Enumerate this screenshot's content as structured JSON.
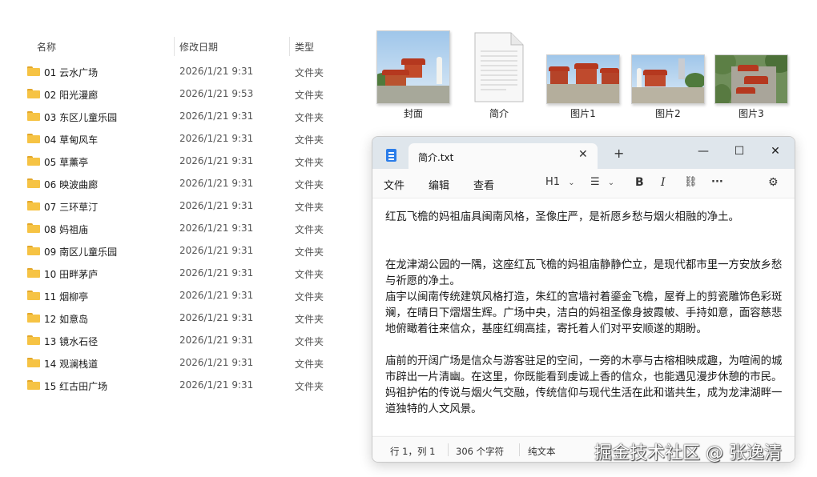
{
  "columns": {
    "name": "名称",
    "date": "修改日期",
    "type": "类型"
  },
  "rows": [
    {
      "name": "01 云水广场",
      "date": "2026/1/21 9:31",
      "type": "文件夹"
    },
    {
      "name": "02 阳光漫廊",
      "date": "2026/1/21 9:53",
      "type": "文件夹"
    },
    {
      "name": "03 东区儿童乐园",
      "date": "2026/1/21 9:31",
      "type": "文件夹"
    },
    {
      "name": "04 草甸风车",
      "date": "2026/1/21 9:31",
      "type": "文件夹"
    },
    {
      "name": "05 草薰亭",
      "date": "2026/1/21 9:31",
      "type": "文件夹"
    },
    {
      "name": "06 映波曲廊",
      "date": "2026/1/21 9:31",
      "type": "文件夹"
    },
    {
      "name": "07 三环草汀",
      "date": "2026/1/21 9:31",
      "type": "文件夹"
    },
    {
      "name": "08 妈祖庙",
      "date": "2026/1/21 9:31",
      "type": "文件夹"
    },
    {
      "name": "09 南区儿童乐园",
      "date": "2026/1/21 9:31",
      "type": "文件夹"
    },
    {
      "name": "10 田畔茅庐",
      "date": "2026/1/21 9:31",
      "type": "文件夹"
    },
    {
      "name": "11 烟柳亭",
      "date": "2026/1/21 9:31",
      "type": "文件夹"
    },
    {
      "name": "12 如意岛",
      "date": "2026/1/21 9:31",
      "type": "文件夹"
    },
    {
      "name": "13 镜水石径",
      "date": "2026/1/21 9:31",
      "type": "文件夹"
    },
    {
      "name": "14 观澜栈道",
      "date": "2026/1/21 9:31",
      "type": "文件夹"
    },
    {
      "name": "15 红古田广场",
      "date": "2026/1/21 9:31",
      "type": "文件夹"
    }
  ],
  "thumbnails": [
    {
      "label": "封面",
      "kind": "image"
    },
    {
      "label": "简介",
      "kind": "text-file"
    },
    {
      "label": "图片1",
      "kind": "image"
    },
    {
      "label": "图片2",
      "kind": "image"
    },
    {
      "label": "图片3",
      "kind": "image"
    }
  ],
  "notepad": {
    "tab_title": "简介.txt",
    "tab_close": "✕",
    "tab_add": "+",
    "window_buttons": {
      "minimize": "—",
      "maximize": "☐",
      "close": "✕"
    },
    "menu": [
      "文件",
      "编辑",
      "查看"
    ],
    "toolbar": {
      "heading": "H1",
      "list": "☰",
      "bold": "B",
      "italic": "I",
      "link": "⛓",
      "more": "···",
      "settings": "⚙"
    },
    "content": [
      "红瓦飞檐的妈祖庙具闽南风格，圣像庄严，是祈愿乡愁与烟火相融的净土。",
      "在龙津湖公园的一隅，这座红瓦飞檐的妈祖庙静静伫立，是现代都市里一方安放乡愁与祈愿的净土。",
      "庙宇以闽南传统建筑风格打造，朱红的宫墙衬着鎏金飞檐，屋脊上的剪瓷雕饰色彩斑斓，在晴日下熠熠生辉。广场中央，洁白的妈祖圣像身披霞帔、手持如意，面容慈悲地俯瞰着往来信众，基座红绸高挂，寄托着人们对平安顺遂的期盼。",
      "庙前的开阔广场是信众与游客驻足的空间，一旁的木亭与古榕相映成趣，为喧闹的城市辟出一片清幽。在这里，你既能看到虔诚上香的信众，也能遇见漫步休憩的市民。妈祖护佑的传说与烟火气交融，传统信仰与现代生活在此和谐共生，成为龙津湖畔一道独特的人文风景。"
    ],
    "status": {
      "position": "行 1，列 1",
      "chars": "306 个字符",
      "format": "纯文本"
    }
  },
  "watermark": "掘金技术社区 @ 张逸清",
  "colors": {
    "folder": "#f6c344",
    "titlebar": "#dfe6ec",
    "roof": "#b5381f"
  }
}
